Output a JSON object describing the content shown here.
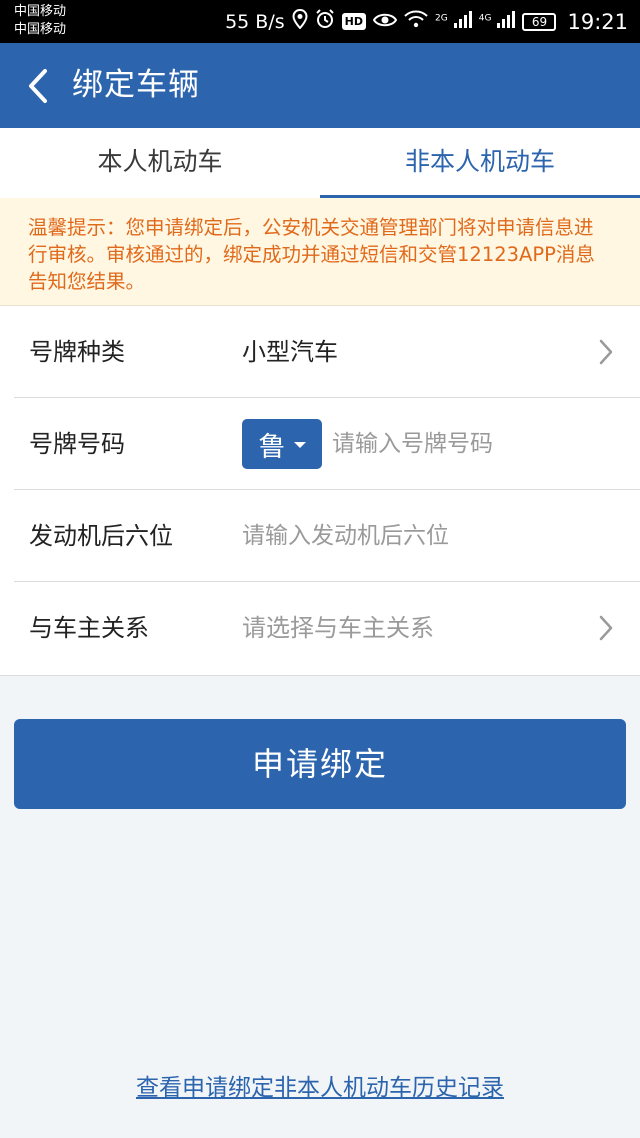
{
  "status_bar": {
    "carrier_1": "中国移动",
    "carrier_2": "中国移动",
    "net_speed": "55 B/s",
    "hd_label": "HD",
    "sig_2g": "2G",
    "sig_4g": "4G",
    "battery": "69",
    "time": "19:21"
  },
  "header": {
    "title": "绑定车辆"
  },
  "tabs": [
    {
      "label": "本人机动车",
      "active": false
    },
    {
      "label": "非本人机动车",
      "active": true
    }
  ],
  "notice": {
    "text": "温馨提示：您申请绑定后，公安机关交通管理部门将对申请信息进行审核。审核通过的，绑定成功并通过短信和交管12123APP消息告知您结果。"
  },
  "form": {
    "plate_type": {
      "label": "号牌种类",
      "value": "小型汽车"
    },
    "plate_number": {
      "label": "号牌号码",
      "province": "鲁",
      "placeholder": "请输入号牌号码"
    },
    "engine": {
      "label": "发动机后六位",
      "placeholder": "请输入发动机后六位"
    },
    "relation": {
      "label": "与车主关系",
      "placeholder": "请选择与车主关系"
    }
  },
  "submit": {
    "label": "申请绑定"
  },
  "history_link": {
    "label": "查看申请绑定非本人机动车历史记录"
  },
  "colors": {
    "primary": "#2c64ad",
    "notice_bg": "#fff7e2",
    "notice_text": "#e06a1c",
    "page_bg": "#f1f5f8"
  }
}
